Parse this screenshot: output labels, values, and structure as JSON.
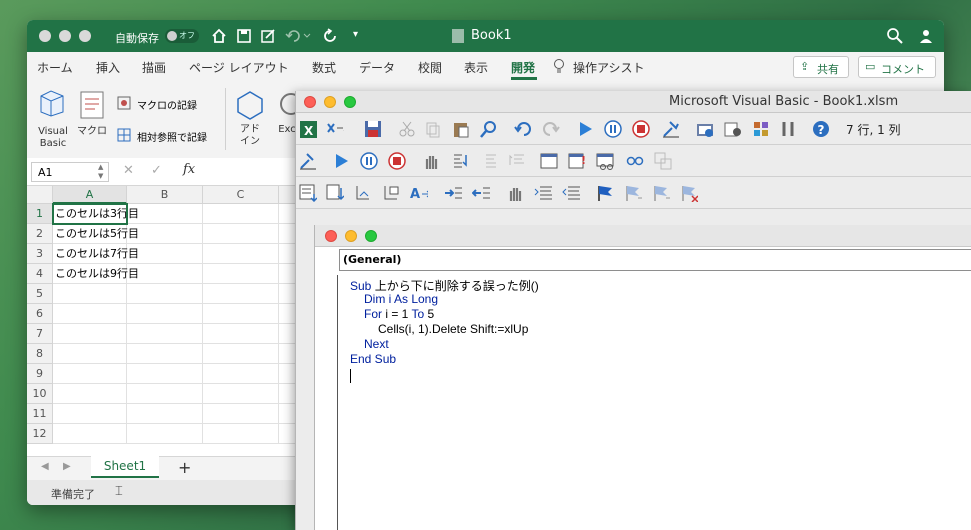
{
  "excel": {
    "autosave_label": "自動保存",
    "autosave_state": "オフ",
    "doc_title": "Book1",
    "tabs": [
      "ホーム",
      "挿入",
      "描画",
      "ページ レイアウト",
      "数式",
      "データ",
      "校閲",
      "表示",
      "開発",
      "操作アシスト"
    ],
    "active_tab": "開発",
    "share_label": "共有",
    "comment_label": "コメント",
    "ribbon": {
      "visual_basic": "Visual Basic",
      "macro": "マクロ",
      "record_macro": "マクロの記録",
      "relative_ref": "相対参照で記録",
      "addin": "アド イン",
      "excel_addin": "Exc"
    },
    "name_box": "A1",
    "fx": "fx",
    "columns": [
      "A",
      "B",
      "C"
    ],
    "rows": [
      "1",
      "2",
      "3",
      "4",
      "5",
      "6",
      "7",
      "8",
      "9",
      "10",
      "11",
      "12"
    ],
    "cells": [
      "このセルは3行目",
      "このセルは5行目",
      "このセルは7行目",
      "このセルは9行目"
    ],
    "sheet_tab": "Sheet1",
    "status": "準備完了",
    "accent": "#217346"
  },
  "vbe": {
    "title": "Microsoft Visual Basic - Book1.xlsm",
    "cursor_pos": "7 行, 1 列",
    "proc_box": "(General)",
    "code": {
      "l1_kw": "Sub",
      "l1_rest": " 上から下に削除する誤った例()",
      "l2_kw": "Dim i As Long",
      "l3_kw1": "For",
      "l3_mid": " i = 1 ",
      "l3_kw2": "To",
      "l3_end": " 5",
      "l4": "Cells(i, 1).Delete Shift:=xlUp",
      "l5_kw": "Next",
      "l6_kw": "End Sub"
    }
  }
}
